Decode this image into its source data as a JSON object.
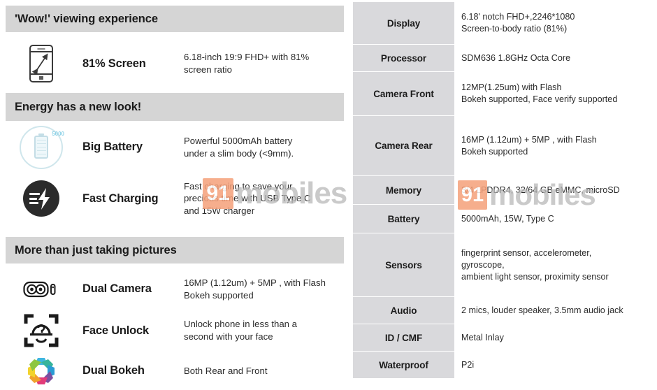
{
  "left_panel": {
    "sections": [
      {
        "header": "'Wow!' viewing experience",
        "features": [
          {
            "icon": "phone-diagonal-icon",
            "title": "81% Screen",
            "desc_lines": [
              "6.18-inch 19:9 FHD+ with 81%",
              "screen ratio"
            ]
          }
        ]
      },
      {
        "header": "Energy has a new look!",
        "features": [
          {
            "icon": "battery-circle-icon",
            "icon_label": "5000",
            "title": "Big Battery",
            "desc_lines": [
              "Powerful 5000mAh battery",
              "under a slim body (<9mm)."
            ]
          },
          {
            "icon": "fast-charge-bolt-icon",
            "title": "Fast Charging",
            "desc_lines": [
              "Fast charging to save your",
              "precious time with USB Type C",
              "and 15W charger"
            ]
          }
        ]
      },
      {
        "header": "More than just taking pictures",
        "features": [
          {
            "icon": "dual-camera-icon",
            "title": "Dual Camera",
            "desc_lines": [
              "16MP (1.12um) + 5MP  , with Flash",
              "Bokeh supported"
            ]
          },
          {
            "icon": "face-unlock-icon",
            "title": "Face Unlock",
            "desc_lines": [
              "Unlock phone in less than a",
              "second with your face"
            ]
          },
          {
            "icon": "dual-bokeh-aperture-icon",
            "title": "Dual Bokeh",
            "desc_lines": [
              "Both Rear and Front"
            ]
          }
        ]
      }
    ]
  },
  "right_panel": {
    "rows": [
      {
        "label": "Display",
        "values": [
          "6.18'  notch FHD+,2246*1080",
          "Screen-to-body ratio (81%)"
        ]
      },
      {
        "label": "Processor",
        "values": [
          "SDM636 1.8GHz Octa Core"
        ]
      },
      {
        "label": "Camera Front",
        "values": [
          "12MP(1.25um) with Flash",
          "Bokeh supported,  Face verify supported"
        ]
      },
      {
        "label": "Camera Rear",
        "values": [
          "16MP (1.12um) + 5MP  , with Flash",
          "Bokeh supported"
        ]
      },
      {
        "label": "Memory",
        "values": [
          "3/4 LPDDR4, 32/64 GB eMMC, microSD"
        ]
      },
      {
        "label": "Battery",
        "values": [
          "5000mAh, 15W,  Type C"
        ]
      },
      {
        "label": "Sensors",
        "values": [
          "fingerprint sensor,  accelerometer,",
          "gyroscope,",
          "ambient light sensor, proximity sensor"
        ]
      },
      {
        "label": "Audio",
        "values": [
          "2 mics, louder speaker, 3.5mm audio jack"
        ]
      },
      {
        "label": "ID / CMF",
        "values": [
          "Metal Inlay"
        ]
      },
      {
        "label": "Waterproof",
        "values": [
          "P2i"
        ]
      }
    ]
  },
  "watermarks": [
    {
      "badge": "91",
      "text": "mobiles"
    },
    {
      "badge": "91",
      "text": "mobiles"
    }
  ],
  "colors": {
    "section_header_bg": "#d5d5d5",
    "spec_label_bg": "#d9d9dc",
    "text": "#231f20",
    "watermark_badge": "#f5a07a",
    "watermark_text": "#b9b9b9",
    "battery_accent": "#8fd3e8",
    "bolt_circle": "#2b2b2b"
  }
}
